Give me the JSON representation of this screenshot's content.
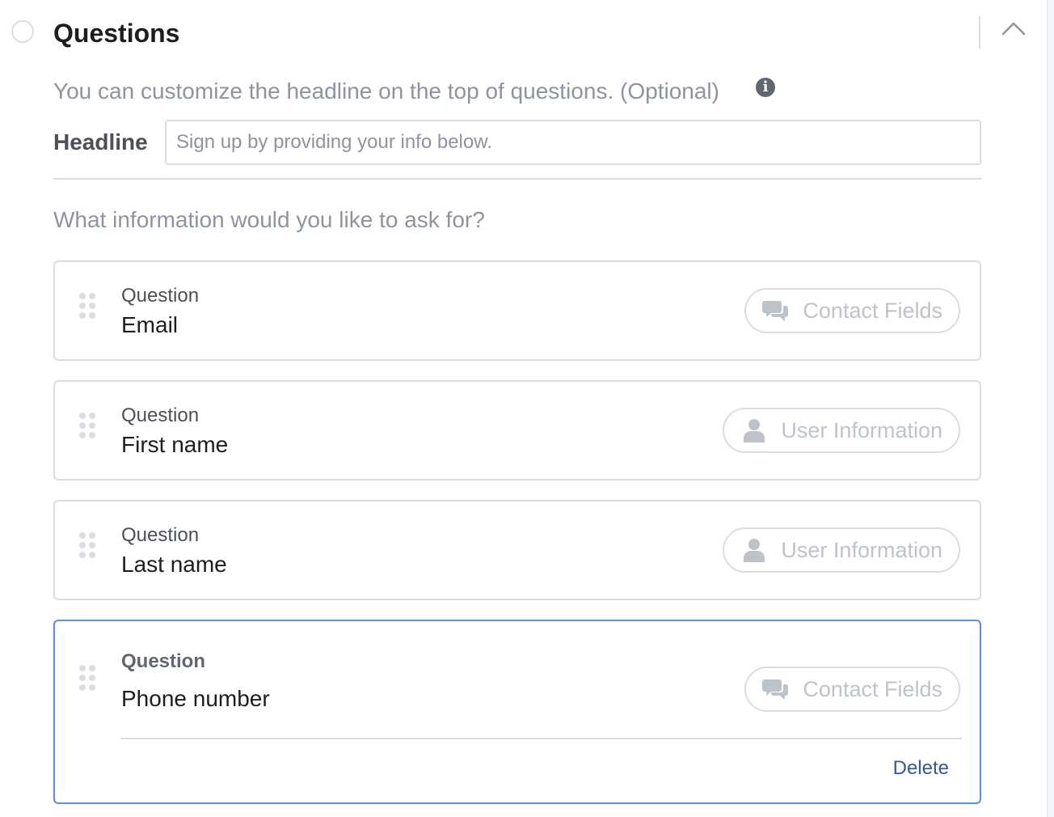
{
  "section": {
    "title": "Questions",
    "collapse_icon": "chevron-up-icon"
  },
  "headline_section": {
    "description": "You can customize the headline on the top of questions. (Optional)",
    "info_icon": "i",
    "label": "Headline",
    "placeholder": "Sign up by providing your info below."
  },
  "questions_prompt": "What information would you like to ask for?",
  "questions": [
    {
      "label": "Question",
      "value": "Email",
      "tag": "Contact Fields",
      "tag_icon": "chat-bubbles-icon"
    },
    {
      "label": "Question",
      "value": "First name",
      "tag": "User Information",
      "tag_icon": "user-icon"
    },
    {
      "label": "Question",
      "value": "Last name",
      "tag": "User Information",
      "tag_icon": "user-icon"
    },
    {
      "label": "Question",
      "value": "Phone number",
      "tag": "Contact Fields",
      "tag_icon": "chat-bubbles-icon",
      "selected": true,
      "delete_label": "Delete"
    }
  ],
  "colors": {
    "active_border": "#5b8ee6",
    "link": "#365899",
    "muted_text": "#8d949e",
    "border": "#dadde1"
  }
}
